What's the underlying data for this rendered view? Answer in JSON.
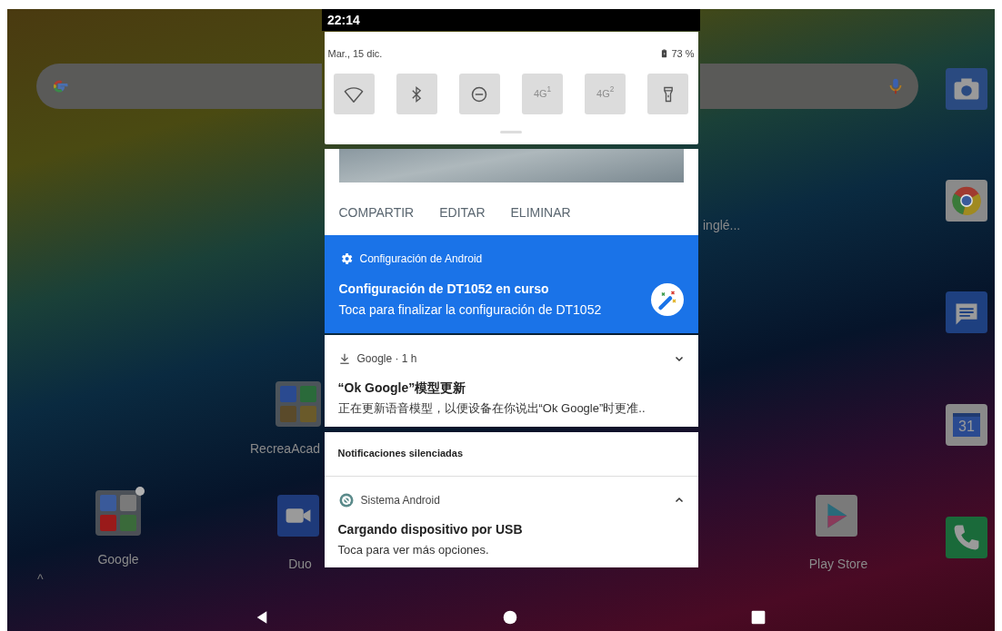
{
  "home": {
    "side_text": "inglé...",
    "dock": [
      {
        "kind": "camera"
      },
      {
        "kind": "chrome"
      },
      {
        "kind": "messages"
      },
      {
        "kind": "calendar",
        "label": "31"
      },
      {
        "kind": "phone"
      }
    ],
    "items": [
      {
        "kind": "folder",
        "label": "RecreaAcad",
        "badge": false
      },
      {
        "kind": "folder",
        "label": "Google",
        "badge": true
      },
      {
        "kind": "duo",
        "label": "Duo"
      },
      {
        "kind": "play",
        "label": "Play Store"
      }
    ],
    "drawer_handle": "^"
  },
  "status_bar": {
    "time": "22:14"
  },
  "quick_settings": {
    "date": "Mar., 15 dic.",
    "battery": "73 %",
    "tiles": [
      {
        "kind": "wifi",
        "disabled": false
      },
      {
        "kind": "bluetooth",
        "disabled": false
      },
      {
        "kind": "dnd",
        "disabled": false
      },
      {
        "kind": "text",
        "label": "4G$^{1}$",
        "disabled": true
      },
      {
        "kind": "text",
        "label": "4G$^{2}$",
        "disabled": true
      },
      {
        "kind": "flashlight",
        "disabled": false
      }
    ]
  },
  "notifications": [
    {
      "kind": "screenshot",
      "actions": [
        "COMPARTIR",
        "EDITAR",
        "ELIMINAR"
      ]
    },
    {
      "kind": "setup",
      "app": "Configuración de Android",
      "title": "Configuración de DT1052 en curso",
      "text": "Toca para finalizar la configuración de DT1052"
    },
    {
      "kind": "download",
      "app": "Google · 1 h",
      "title": "“Ok Google”模型更新",
      "text": "正在更新语音模型，以便设备在你说出“Ok Google”时更准..",
      "expanded": false
    },
    {
      "kind": "header",
      "label": "Notificaciones silenciadas"
    },
    {
      "kind": "system",
      "app": "Sistema Android",
      "title": "Cargando dispositivo por USB",
      "text": "Toca para ver más opciones.",
      "expanded": true
    }
  ],
  "nav_bar": {
    "buttons": [
      {
        "kind": "back"
      },
      {
        "kind": "home"
      },
      {
        "kind": "recents"
      }
    ]
  }
}
